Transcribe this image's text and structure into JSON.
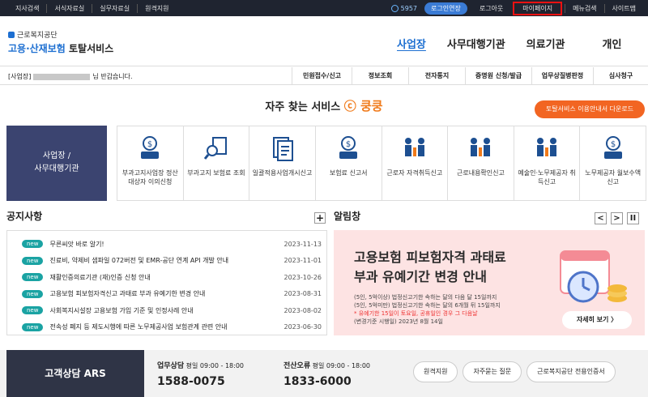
{
  "topbar": {
    "left": [
      "지사검색",
      "서식자료실",
      "실무자료실",
      "원격지원"
    ],
    "timer": "5957",
    "extend": "로그인연장",
    "logout": "로그아웃",
    "mypage": "마이페이지",
    "menu_search": "메뉴검색",
    "sitemap": "사이트맵"
  },
  "header": {
    "org": "근로복지공단",
    "title_blue": "고용·산재보험",
    "title_dark": "토탈서비스",
    "gnb": [
      "사업장",
      "사무대행기관",
      "의료기관",
      "개인"
    ]
  },
  "subnav": {
    "greet_prefix": "[사업장]",
    "greet_suffix": "님 반갑습니다.",
    "menus": [
      "민원접수/신고",
      "정보조회",
      "전자통지",
      "증명원 신청/발급",
      "업무상질병판정",
      "심사청구"
    ]
  },
  "quick": {
    "title": "자주 찾는 서비스",
    "logo": "ⓒ 쿵쿵",
    "download": "토탈서비스 이용안내서 다운로드",
    "box": [
      "사업장 /",
      "사무대행기관"
    ],
    "items": [
      {
        "label": "부과고지사업장 정산대상자 이의신청",
        "icon": "money-person-icon"
      },
      {
        "label": "부과고지 보험료 조회",
        "icon": "search-document-icon"
      },
      {
        "label": "일괄적용사업개시신고",
        "icon": "document-stack-icon"
      },
      {
        "label": "보험료 신고서",
        "icon": "money-person-icon"
      },
      {
        "label": "근로자 자격취득신고",
        "icon": "people-chart-icon"
      },
      {
        "label": "근로내용확인신고",
        "icon": "people-chart-icon"
      },
      {
        "label": "예술인·노무제공자 취득신고",
        "icon": "people-chart-icon"
      },
      {
        "label": "노무제공자 월보수액 신고",
        "icon": "money-person-icon"
      }
    ]
  },
  "notice": {
    "title": "공지사항",
    "plus": "+",
    "badge": "new",
    "items": [
      {
        "text": "무른씨앗 바로 알기!",
        "date": "2023-11-13"
      },
      {
        "text": "진료비, 약제비 샘파일 072버전 및 EMR-공단 연계 API 개발 안내",
        "date": "2023-11-01"
      },
      {
        "text": "재활인증의료기관 (재)인증 신청 안내",
        "date": "2023-10-26"
      },
      {
        "text": "고용보험 피보험자격신고 과태료 부과 유예기한 변경 안내",
        "date": "2023-08-31"
      },
      {
        "text": "사회복지시설장 고용보험 가입 기준 및 인정사례 안내",
        "date": "2023-08-02"
      },
      {
        "text": "전속성 폐지 등 제도시행에 따른 노무제공사업 보험관계 관련 안내",
        "date": "2023-06-30"
      }
    ]
  },
  "alarm": {
    "title": "알림창",
    "prev": "<",
    "next": ">",
    "pause": "II",
    "line1": "고용보험 피보험자격 과태료",
    "line2": "부과 유예기간 변경 안내",
    "s1": "(5인, 5억이상) 법정신고기한 속하는 달의 다음 달 15일까지",
    "s2": "(5인, 5억미만) 법정신고기한 속하는 달의 6개월 뒤 15일까지",
    "s3": "* 유예기한 15일이 토요일, 공휴일인 경우 그 다음날",
    "s4": "(변경기준 시행일) 2023년 8월 14일",
    "more": "자세히 보기  〉"
  },
  "footer": {
    "ars": "고객상담 ARS",
    "t1": "업무상담",
    "t1h": "평일 09:00 - 18:00",
    "t1n": "1588-0075",
    "t2": "전산오류",
    "t2h": "평일 09:00 - 18:00",
    "t2n": "1833-6000",
    "btns": [
      "원격지원",
      "자주묻는 질문",
      "근로복지공단 전용인증서"
    ]
  }
}
